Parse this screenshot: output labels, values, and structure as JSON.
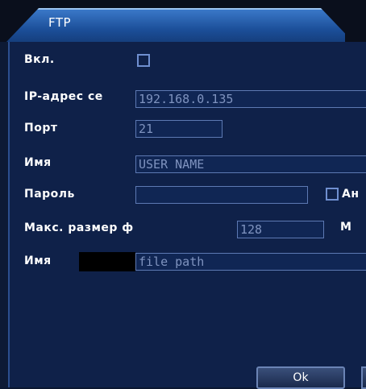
{
  "window": {
    "title": "FTP"
  },
  "form": {
    "enable_label": "Вкл.",
    "ip_label": "IP-адрес се",
    "ip_value": "192.168.0.135",
    "port_label": "Порт",
    "port_value": "21",
    "name_label": "Имя",
    "name_value": "USER NAME",
    "password_label": "Пароль",
    "password_value": "",
    "anonymous_label": "Ан",
    "maxsize_label": "Макс. размер ф",
    "maxsize_value": "128",
    "maxsize_unit": "M",
    "path_label": "Имя",
    "path_value": "file path"
  },
  "buttons": {
    "ok_label": "Ok"
  },
  "colors": {
    "title_tab": "#2a63b0",
    "panel": "#0f2149",
    "field_border": "#5d79b3",
    "field_text": "#7f93bf"
  }
}
